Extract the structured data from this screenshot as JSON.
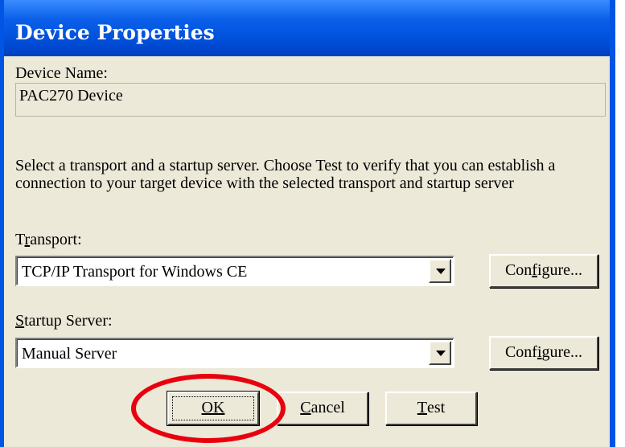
{
  "window": {
    "title": "Device Properties"
  },
  "device_name": {
    "label": "Device Name:",
    "value": "PAC270 Device"
  },
  "description": "Select a transport and a startup server. Choose Test to verify that you can establish a connection to your target device with the selected transport and startup server",
  "transport": {
    "label_prefix": "T",
    "label_mnemonic": "r",
    "label_suffix": "ansport:",
    "selected": "TCP/IP Transport for Windows CE",
    "configure_prefix": "Con",
    "configure_mnemonic": "f",
    "configure_suffix": "igure..."
  },
  "startup_server": {
    "label_prefix": "",
    "label_mnemonic": "S",
    "label_suffix": "tartup Server:",
    "selected": "Manual Server",
    "configure_prefix": "Conf",
    "configure_mnemonic": "i",
    "configure_suffix": "gure..."
  },
  "buttons": {
    "ok": "OK",
    "cancel_mnemonic": "C",
    "cancel_suffix": "ancel",
    "test_mnemonic": "T",
    "test_suffix": "est"
  },
  "colors": {
    "titlebar": "#0055e5",
    "dialog_bg": "#ece9d8",
    "highlight_ring": "#e8000e"
  }
}
